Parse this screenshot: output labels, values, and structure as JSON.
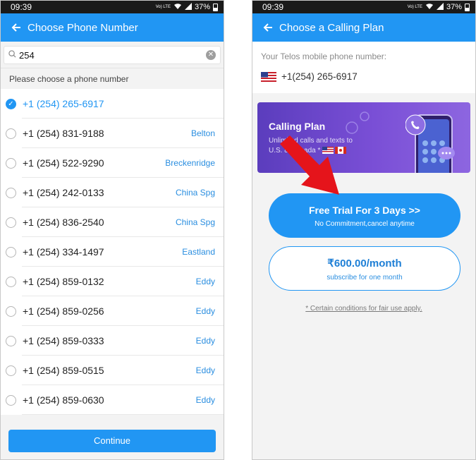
{
  "left": {
    "status": {
      "time": "09:39",
      "lte": "Vo) LTE",
      "battery": "37%"
    },
    "appbar_title": "Choose Phone Number",
    "search": {
      "value": "254",
      "placeholder": ""
    },
    "hint": "Please choose a phone number",
    "numbers": [
      {
        "number": "+1 (254) 265-6917",
        "city": "",
        "selected": true
      },
      {
        "number": "+1 (254) 831-9188",
        "city": "Belton"
      },
      {
        "number": "+1 (254) 522-9290",
        "city": "Breckenridge"
      },
      {
        "number": "+1 (254) 242-0133",
        "city": "China Spg"
      },
      {
        "number": "+1 (254) 836-2540",
        "city": "China Spg"
      },
      {
        "number": "+1 (254) 334-1497",
        "city": "Eastland"
      },
      {
        "number": "+1 (254) 859-0132",
        "city": "Eddy"
      },
      {
        "number": "+1 (254) 859-0256",
        "city": "Eddy"
      },
      {
        "number": "+1 (254) 859-0333",
        "city": "Eddy"
      },
      {
        "number": "+1 (254) 859-0515",
        "city": "Eddy"
      },
      {
        "number": "+1 (254) 859-0630",
        "city": "Eddy"
      }
    ],
    "continue_label": "Continue"
  },
  "right": {
    "status": {
      "time": "09:39",
      "lte": "Vo) LTE",
      "battery": "37%"
    },
    "appbar_title": "Choose a Calling Plan",
    "my_number_label": "Your Telos mobile phone number:",
    "my_number": "+1(254) 265-6917",
    "banner": {
      "title": "Calling Plan",
      "subtitle_line1": "Unlimited calls and texts to",
      "subtitle_line2": "U.S. & Canada *"
    },
    "trial": {
      "title": "Free Trial For 3 Days >>",
      "subtitle": "No Commitment,cancel anytime"
    },
    "monthly": {
      "title": "₹600.00/month",
      "subtitle": "subscribe for one month"
    },
    "conditions": "* Certain conditions for fair use apply."
  },
  "colors": {
    "primary": "#2196f3",
    "banner": "#7a4fd6",
    "annotation_arrow": "#e5141b"
  }
}
